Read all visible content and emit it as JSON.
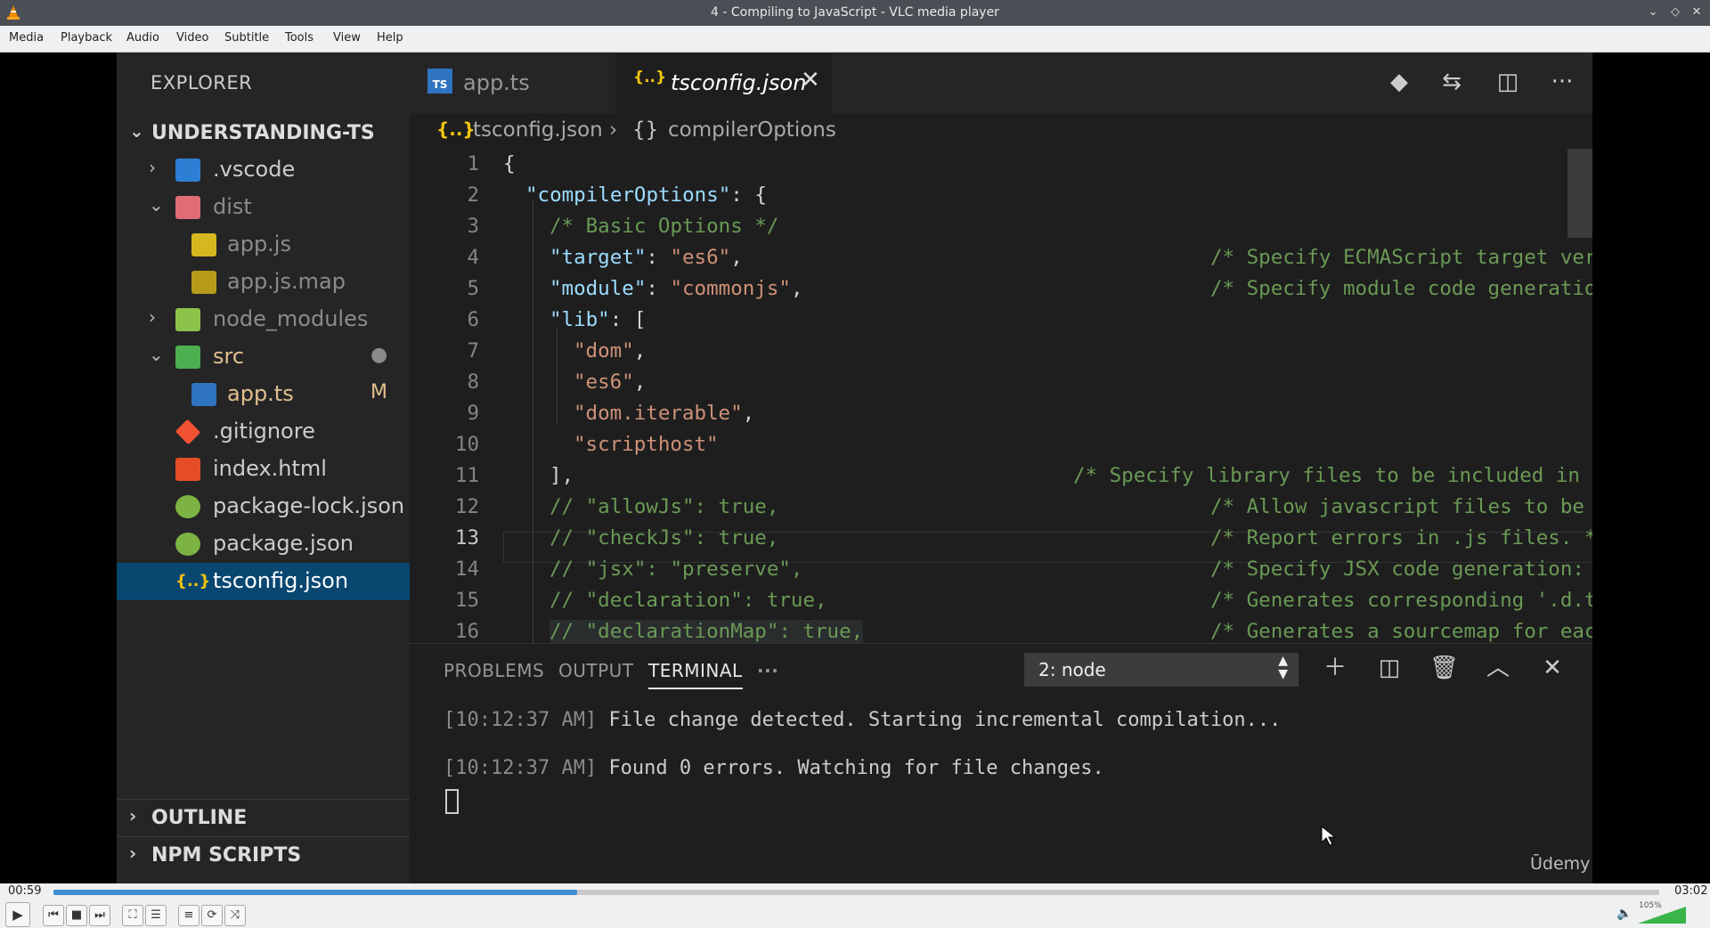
{
  "window": {
    "title": "4 - Compiling to JavaScript - VLC media player"
  },
  "menu": [
    "Media",
    "Playback",
    "Audio",
    "Video",
    "Subtitle",
    "Tools",
    "View",
    "Help"
  ],
  "explorer": {
    "header": "EXPLORER",
    "project": "UNDERSTANDING-TS",
    "items": [
      {
        "label": ".vscode"
      },
      {
        "label": "dist"
      },
      {
        "label": "app.js"
      },
      {
        "label": "app.js.map"
      },
      {
        "label": "node_modules"
      },
      {
        "label": "src"
      },
      {
        "label": "app.ts",
        "badge": "M"
      },
      {
        "label": ".gitignore"
      },
      {
        "label": "index.html"
      },
      {
        "label": "package-lock.json"
      },
      {
        "label": "package.json"
      },
      {
        "label": "tsconfig.json"
      }
    ],
    "outline": "OUTLINE",
    "npm_scripts": "NPM SCRIPTS"
  },
  "tabs": [
    {
      "label": "app.ts",
      "icon_text": "TS"
    },
    {
      "label": "tsconfig.json",
      "icon_text": "{..}"
    }
  ],
  "breadcrumb": {
    "file": "tsconfig.json",
    "symbol": "compilerOptions",
    "file_icon": "{..}",
    "symbol_icon": "{}"
  },
  "code": {
    "line_numbers": [
      "1",
      "2",
      "3",
      "4",
      "5",
      "6",
      "7",
      "8",
      "9",
      "10",
      "11",
      "12",
      "13",
      "14",
      "15",
      "16"
    ],
    "current_line": "13",
    "lines": [
      {
        "text": "{"
      },
      {
        "key": "\"compilerOptions\"",
        "rest": ": {"
      },
      {
        "comment_inline": "/* Basic Options */"
      },
      {
        "key": "\"target\"",
        "sep": ": ",
        "str": "\"es6\"",
        "end": ",",
        "comment": "/* Specify ECMAScript target version: 'E"
      },
      {
        "key": "\"module\"",
        "sep": ": ",
        "str": "\"commonjs\"",
        "end": ",",
        "comment": "/* Specify module code generation: 'none"
      },
      {
        "key": "\"lib\"",
        "rest": ": ["
      },
      {
        "str": "\"dom\"",
        "end": ","
      },
      {
        "str": "\"es6\"",
        "end": ","
      },
      {
        "str": "\"dom.iterable\"",
        "end": ","
      },
      {
        "str": "\"scripthost\""
      },
      {
        "text": "],",
        "comment": "/* Specify library files to be included in the comp"
      },
      {
        "comment_inline": "// \"allowJs\": true,",
        "comment": "/* Allow javascript files to be compiled"
      },
      {
        "comment_inline": "// \"checkJs\": true,",
        "comment": "/* Report errors in .js files. */"
      },
      {
        "comment_inline": "// \"jsx\": \"preserve\",",
        "comment": "/* Specify JSX code generation: 'preserv"
      },
      {
        "comment_inline": "// \"declaration\": true,",
        "comment": "/* Generates corresponding '.d.ts' file."
      },
      {
        "comment_inline": "// \"declarationMap\": true,",
        "comment": "/* Generates a sourcemap for each corres"
      }
    ]
  },
  "panel": {
    "tabs": [
      "PROBLEMS",
      "OUTPUT",
      "TERMINAL"
    ],
    "more": "···",
    "terminal_select": "2: node",
    "lines": [
      {
        "ts": "[10:12:37 AM]",
        "msg": "File change detected. Starting incremental compilation..."
      },
      {
        "ts": "[10:12:37 AM]",
        "msg": "Found 0 errors. Watching for file changes."
      }
    ]
  },
  "watermark": "Ūdemy",
  "player": {
    "elapsed": "00:59",
    "total": "03:02",
    "progress_fraction": 0.326,
    "volume_label": "105%",
    "accent": "#3f8ed4"
  }
}
